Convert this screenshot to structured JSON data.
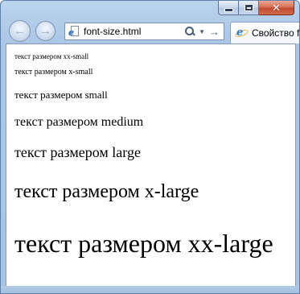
{
  "window": {
    "minimize_icon": "minimize-icon",
    "maximize_icon": "maximize-icon",
    "close_glyph": "✕",
    "close_color": "#c9482b",
    "frame_color": "#aac6e4"
  },
  "nav": {
    "back_glyph": "←",
    "forward_glyph": "→"
  },
  "address": {
    "url": "font-size.html",
    "page_icon": "ie-page-icon",
    "search_icon": "search-icon",
    "dropdown_glyph": "▼",
    "go_glyph": "→"
  },
  "tab": {
    "label": "Свойство f",
    "icon": "ie-icon"
  },
  "content": {
    "lines": [
      "текст размером xx-small",
      "текст размером x-small",
      "текст размером small",
      "текст размером medium",
      "текст размером large",
      "текст размером x-large",
      "текст размером xx-large"
    ]
  }
}
